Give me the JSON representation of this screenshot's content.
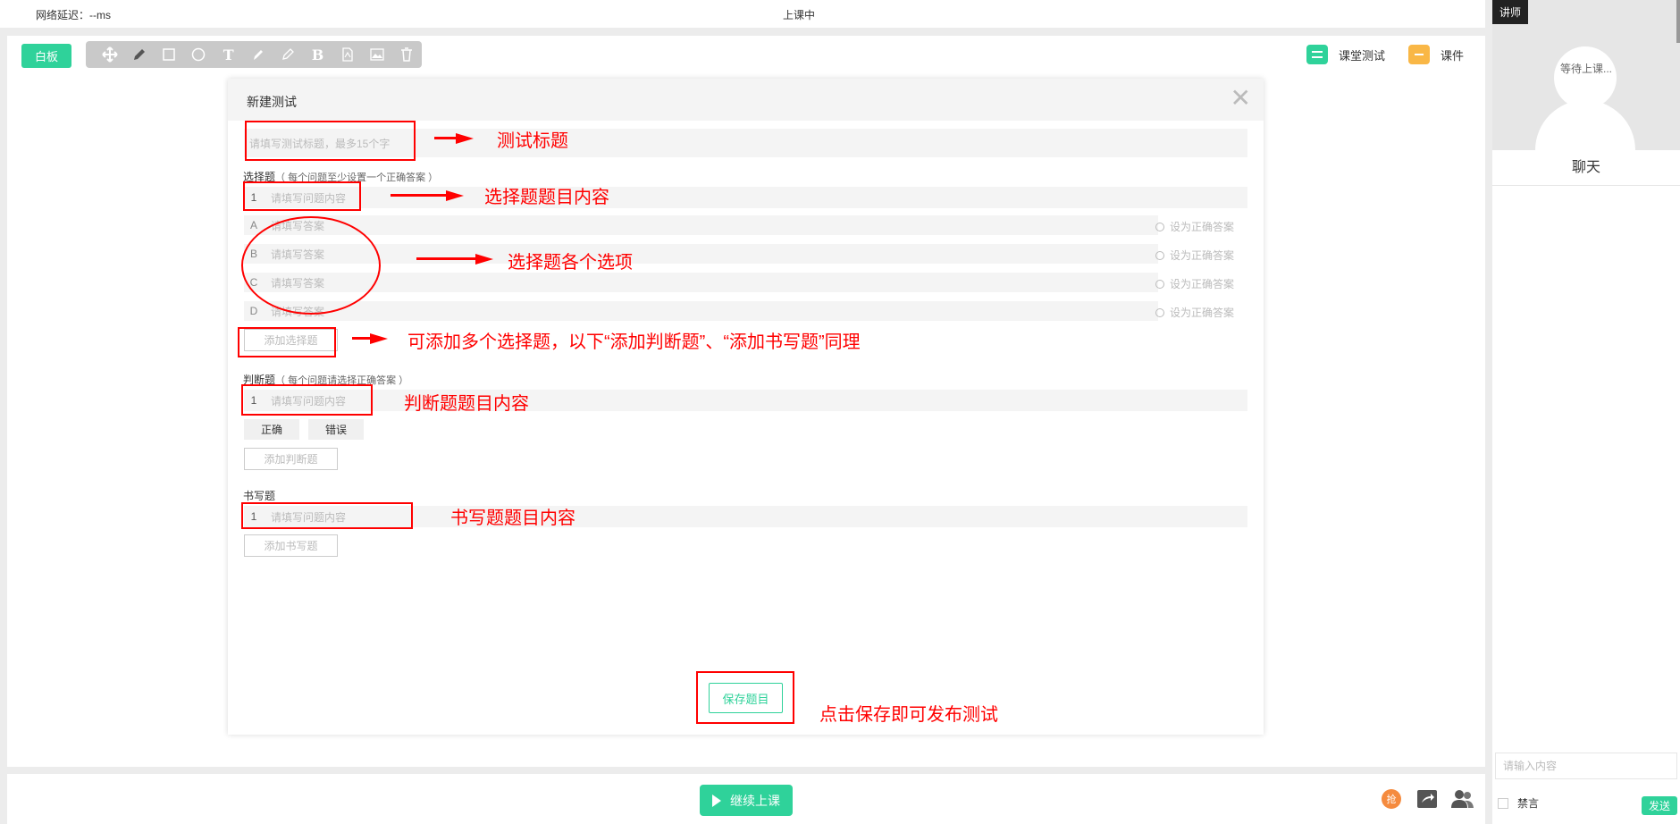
{
  "status": {
    "latency": "网络延迟：--ms",
    "class_state": "上课中"
  },
  "board": {
    "whiteboard_label": "白板",
    "text_tool": "T",
    "bold_tool": "B",
    "quiz_tab": "课堂测试",
    "courseware_tab": "课件"
  },
  "dialog": {
    "title": "新建测试",
    "close": "✕",
    "title_placeholder": "请填写测试标题，最多15个字",
    "choice": {
      "label": "选择题",
      "hint": "（ 每个问题至少设置一个正确答案 ）",
      "question_number": "1",
      "question_placeholder": "请填写问题内容",
      "options": [
        {
          "letter": "A",
          "placeholder": "请填写答案",
          "correct_label": "设为正确答案"
        },
        {
          "letter": "B",
          "placeholder": "请填写答案",
          "correct_label": "设为正确答案"
        },
        {
          "letter": "C",
          "placeholder": "请填写答案",
          "correct_label": "设为正确答案"
        },
        {
          "letter": "D",
          "placeholder": "请填写答案",
          "correct_label": "设为正确答案"
        }
      ],
      "add_label": "添加选择题"
    },
    "judge": {
      "label": "判断题",
      "hint": "（ 每个问题请选择正确答案 ）",
      "question_number": "1",
      "question_placeholder": "请填写问题内容",
      "true_label": "正确",
      "false_label": "错误",
      "add_label": "添加判断题"
    },
    "writing": {
      "label": "书写题",
      "question_number": "1",
      "question_placeholder": "请填写问题内容",
      "add_label": "添加书写题"
    },
    "save_label": "保存题目"
  },
  "annotations": {
    "title": "测试标题",
    "choice_question": "选择题题目内容",
    "choice_options": "选择题各个选项",
    "add_multiple": "可添加多个选择题，以下“添加判断题”、“添加书写题”同理",
    "judge_question": "判断题题目内容",
    "writing_question": "书写题题目内容",
    "save": "点击保存即可发布测试"
  },
  "bottom": {
    "continue_label": "继续上课",
    "grab_label": "抢"
  },
  "right_panel": {
    "teacher_tag": "讲师",
    "waiting_text": "等待上课...",
    "chat_tab": "聊天",
    "chat_placeholder": "请输入内容",
    "mute_label": "禁言",
    "send_label": "发送"
  },
  "colors": {
    "accent": "#2fd29a",
    "annotation": "#ff0000",
    "courseware": "#f9b746"
  }
}
